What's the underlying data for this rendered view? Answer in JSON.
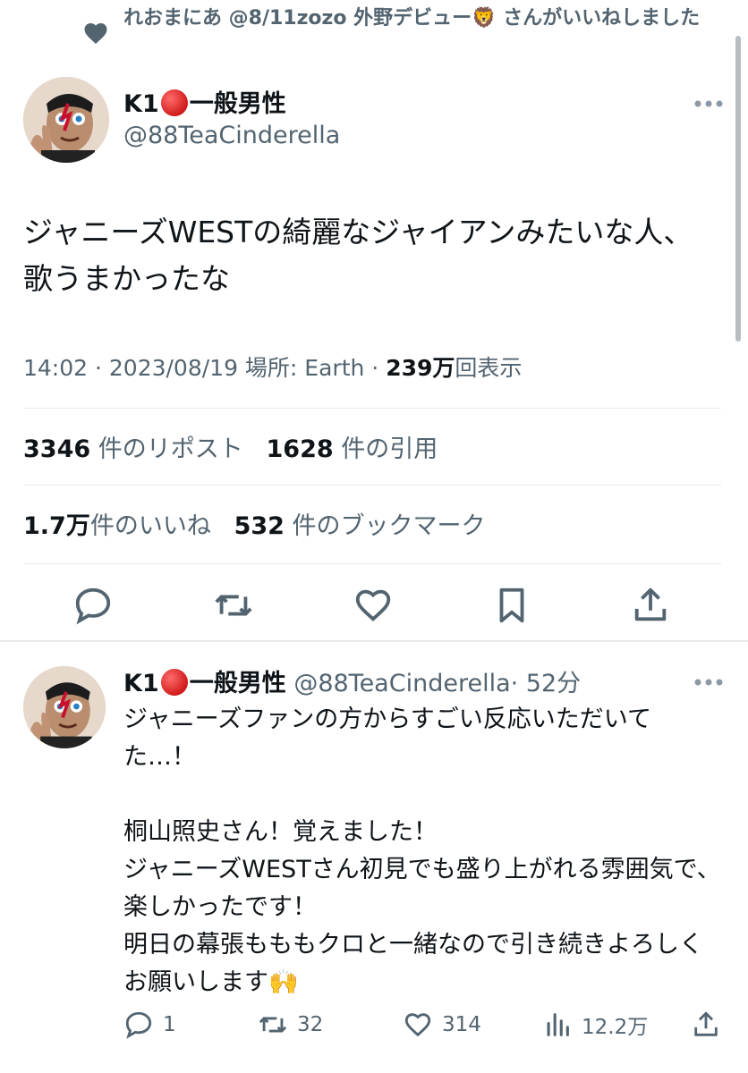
{
  "context": {
    "icon": "heart-icon",
    "text": "れおまにあ @8/11zozo 外野デビュー🦁 さんがいいねしました"
  },
  "main_tweet": {
    "author_name_prefix": "K1",
    "author_name_suffix": "一般男性",
    "handle": "@88TeaCinderella",
    "text": "ジャニーズWESTの綺麗なジャイアンみたいな人、\n歌うまかったな",
    "time": "14:02 · 2023/08/19 場所: Earth · ",
    "views_count": "239万",
    "views_label": "回表示",
    "reposts_count": "3346",
    "reposts_label": " 件のリポスト",
    "quotes_count": "1628",
    "quotes_label": " 件の引用",
    "likes_count": "1.7万",
    "likes_label": "件のいいね",
    "bookmarks_count": "532",
    "bookmarks_label": " 件のブックマーク"
  },
  "reply": {
    "author_name_prefix": "K1",
    "author_name_suffix": "一般男性",
    "handle": "@88TeaCinderella",
    "time_ago": "· 52分",
    "text": "ジャニーズファンの方からすごい反応いただいてた…！\n\n桐山照史さん！覚えました！\nジャニーズWESTさん初見でも盛り上がれる雰囲気で、楽しかったです！\n明日の幕張もももクロと一緒なので引き続きよろしくお願いします🙌",
    "replies": "1",
    "reposts": "32",
    "likes": "314",
    "views": "12.2万"
  },
  "colors": {
    "text": "#0f1419",
    "secondary": "#536471",
    "divider": "#e6e9eb",
    "status_dot": "#d11b1b"
  }
}
